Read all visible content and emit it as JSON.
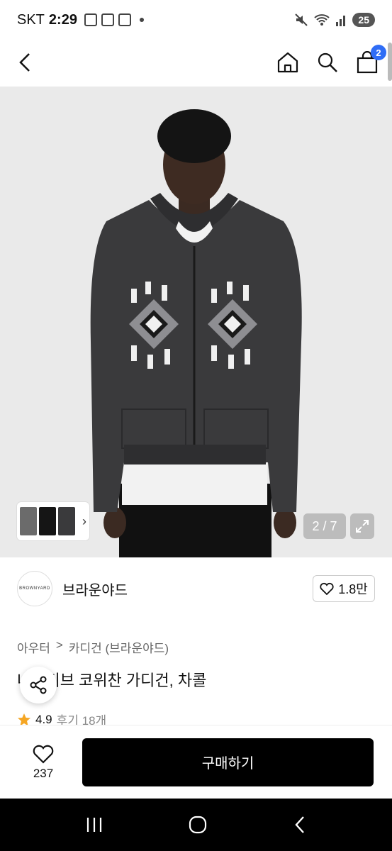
{
  "status": {
    "carrier": "SKT",
    "time": "2:29",
    "battery": "25"
  },
  "nav": {
    "cart_count": "2"
  },
  "gallery": {
    "counter": "2 / 7"
  },
  "brand": {
    "logo_text": "BROWNYARD",
    "name": "브라운야드",
    "likes": "1.8만"
  },
  "breadcrumb": {
    "category": "아우터",
    "separator": ">",
    "subcategory": "카디건 (브라운야드)"
  },
  "product": {
    "title": "네이티브 코위찬 가디건, 차콜",
    "rating": "4.9",
    "reviews": "후기 18개"
  },
  "bottom": {
    "wish_count": "237",
    "buy_label": "구매하기"
  },
  "colors": {
    "accent": "#2f6df6",
    "star": "#f5a623",
    "cardigan": "#3a3a3c"
  }
}
